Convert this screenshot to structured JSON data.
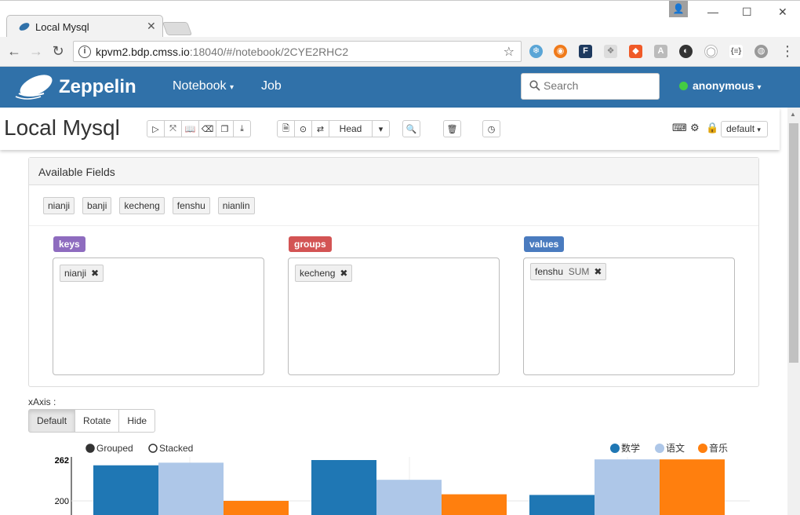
{
  "browser": {
    "tab_title": "Local Mysql",
    "url_host": "kpvm2.bdp.cmss.io",
    "url_rest": ":18040/#/notebook/2CYE2RHC2"
  },
  "header": {
    "brand": "Zeppelin",
    "nav": [
      "Notebook",
      "Job"
    ],
    "search_placeholder": "Search",
    "user": "anonymous"
  },
  "notebook": {
    "title": "Local Mysql",
    "head_label": "Head",
    "interpreter": "default"
  },
  "panel": {
    "title": "Available Fields",
    "fields": [
      "nianji",
      "banji",
      "kecheng",
      "fenshu",
      "nianlin"
    ],
    "keys_label": "keys",
    "groups_label": "groups",
    "values_label": "values",
    "keys_chip": "nianji",
    "groups_chip": "kecheng",
    "values_chip_field": "fenshu",
    "values_chip_agg": "SUM"
  },
  "xaxis": {
    "label": "xAxis :",
    "options": [
      "Default",
      "Rotate",
      "Hide"
    ]
  },
  "chart_data": {
    "type": "bar",
    "mode_options": [
      "Grouped",
      "Stacked"
    ],
    "mode_selected": "Grouped",
    "series": [
      {
        "name": "数学",
        "color": "#1f77b4",
        "values": [
          254,
          262,
          209
        ]
      },
      {
        "name": "语文",
        "color": "#aec7e8",
        "values": [
          258,
          232,
          263
        ]
      },
      {
        "name": "音乐",
        "color": "#ff7f0e",
        "values": [
          200,
          210,
          263
        ]
      }
    ],
    "y_ticks": [
      "262",
      "200"
    ],
    "ylim": [
      170,
      262
    ]
  },
  "colors": {
    "zeppelin_blue": "#3071a9",
    "keys": "#8e6cbf",
    "groups": "#d35454",
    "values": "#4a7bbf"
  }
}
